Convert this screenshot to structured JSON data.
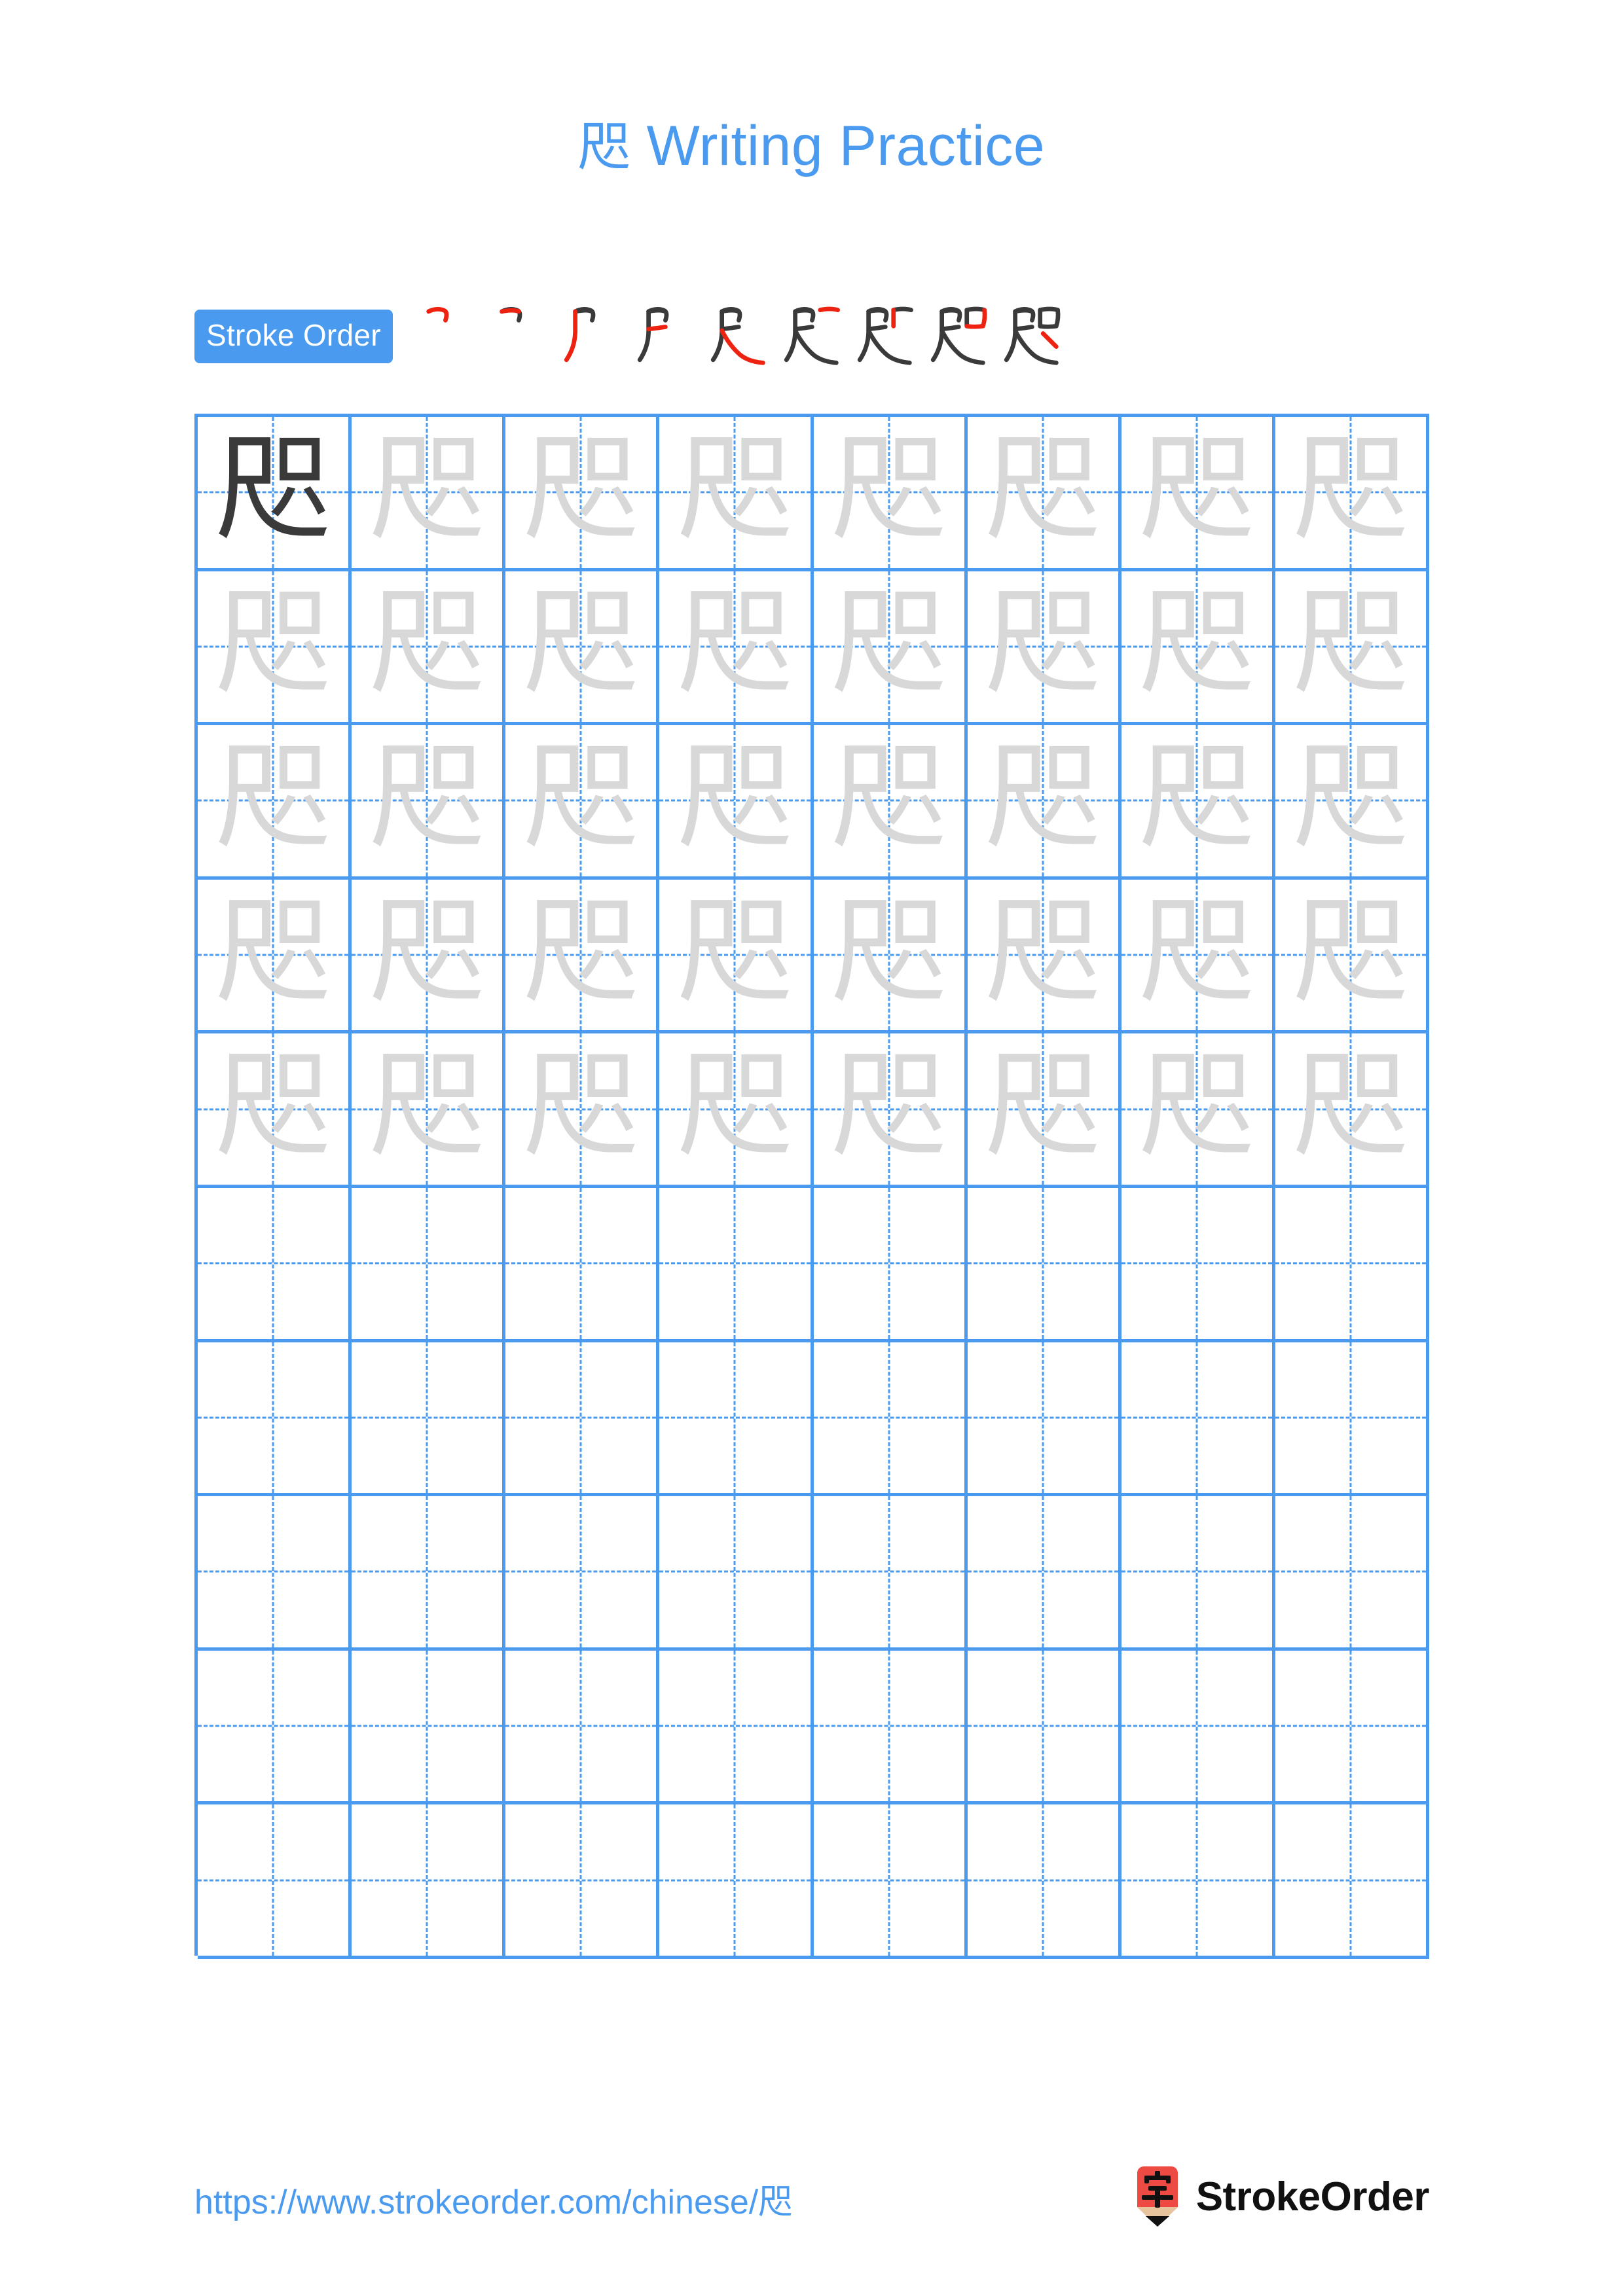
{
  "character": "咫",
  "title": {
    "character": "咫",
    "suffix": " Writing Practice"
  },
  "stroke_order": {
    "badge_label": "Stroke Order",
    "step_count": 9,
    "new_stroke_color": "#ee2211",
    "prev_stroke_color": "#3a3a3a",
    "steps": [
      1,
      2,
      3,
      4,
      5,
      6,
      7,
      8,
      9
    ]
  },
  "grid": {
    "columns": 8,
    "rows": 10,
    "grid_line_color": "#4a9bef",
    "guide_line_color": "#4a9bef",
    "solid_char_color": "#3a3a3a",
    "ghost_char_color": "#d8d8d8",
    "rows_data": [
      [
        "solid",
        "ghost",
        "ghost",
        "ghost",
        "ghost",
        "ghost",
        "ghost",
        "ghost"
      ],
      [
        "ghost",
        "ghost",
        "ghost",
        "ghost",
        "ghost",
        "ghost",
        "ghost",
        "ghost"
      ],
      [
        "ghost",
        "ghost",
        "ghost",
        "ghost",
        "ghost",
        "ghost",
        "ghost",
        "ghost"
      ],
      [
        "ghost",
        "ghost",
        "ghost",
        "ghost",
        "ghost",
        "ghost",
        "ghost",
        "ghost"
      ],
      [
        "ghost",
        "ghost",
        "ghost",
        "ghost",
        "ghost",
        "ghost",
        "ghost",
        "ghost"
      ],
      [
        "empty",
        "empty",
        "empty",
        "empty",
        "empty",
        "empty",
        "empty",
        "empty"
      ],
      [
        "empty",
        "empty",
        "empty",
        "empty",
        "empty",
        "empty",
        "empty",
        "empty"
      ],
      [
        "empty",
        "empty",
        "empty",
        "empty",
        "empty",
        "empty",
        "empty",
        "empty"
      ],
      [
        "empty",
        "empty",
        "empty",
        "empty",
        "empty",
        "empty",
        "empty",
        "empty"
      ],
      [
        "empty",
        "empty",
        "empty",
        "empty",
        "empty",
        "empty",
        "empty",
        "empty"
      ]
    ]
  },
  "footer": {
    "url": "https://www.strokeorder.com/chinese/咫",
    "brand_name": "StrokeOrder",
    "brand_mark_char": "字",
    "brand_mark_color": "#ee4a44"
  },
  "colors": {
    "accent": "#4a9bef",
    "page_background": "#ffffff"
  }
}
